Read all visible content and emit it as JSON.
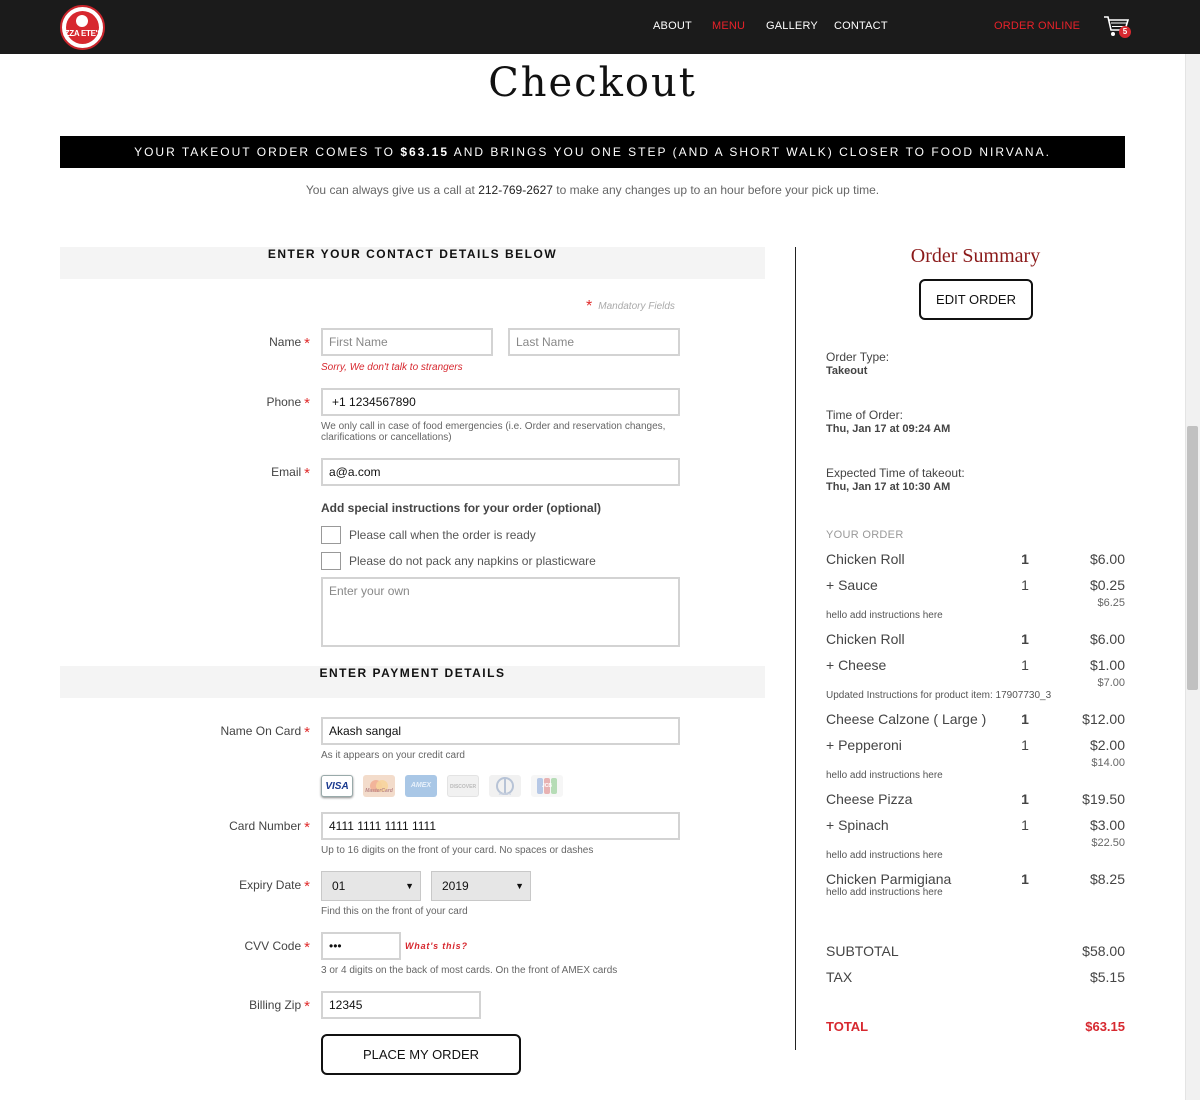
{
  "brand": {
    "logo_text": "IZZA ETE'S",
    "accent": "#d7282f"
  },
  "nav": {
    "about": "ABOUT",
    "menu": "MENU",
    "gallery": "GALLERY",
    "contact": "CONTACT",
    "order_online": "ORDER ONLINE",
    "cart_count": "5"
  },
  "page": {
    "title": "Checkout"
  },
  "banner": {
    "pre": "YOUR TAKEOUT ORDER COMES TO ",
    "amount": "$63.15",
    "post": " AND BRINGS YOU ONE STEP (AND A SHORT WALK) CLOSER TO FOOD NIRVANA."
  },
  "callnote": {
    "pre": "You can always give us a call at ",
    "phone": "212-769-2627",
    "post": " to make any changes up to an hour before your pick up time."
  },
  "contact": {
    "heading": "ENTER YOUR CONTACT DETAILS BELOW",
    "mandatory": "Mandatory Fields",
    "name_label": "Name",
    "first_placeholder": "First Name",
    "last_placeholder": "Last Name",
    "name_error": "Sorry, We don't talk to strangers",
    "phone_label": "Phone",
    "phone_value": "+1 1234567890",
    "phone_help": "We only call in case of food emergencies (i.e. Order and reservation changes, clarifications or cancellations)",
    "email_label": "Email",
    "email_value": "a@a.com",
    "special_heading": "Add special instructions for your order (optional)",
    "opt1": "Please call when the order is ready",
    "opt2": "Please do not pack any napkins or plasticware",
    "own_placeholder": "Enter your own"
  },
  "payment": {
    "heading": "ENTER PAYMENT DETAILS",
    "name_on_card_label": "Name On Card",
    "name_on_card_value": "Akash sangal",
    "name_on_card_help": "As it appears on your credit card",
    "card_logos": [
      "VISA",
      "MasterCard",
      "AMEX",
      "DISCOVER",
      "Diners",
      "JCB"
    ],
    "card_number_label": "Card Number",
    "card_number_value": "4111 1111 1111 1111",
    "card_number_help": "Up to 16 digits on the front of your card. No spaces or dashes",
    "expiry_label": "Expiry Date",
    "expiry_month": "01",
    "expiry_year": "2019",
    "expiry_help": "Find this on the front of your card",
    "cvv_label": "CVV Code",
    "cvv_value": "•••",
    "cvv_link": "What's this?",
    "cvv_help": "3 or 4 digits on the back of most cards. On the front of AMEX cards",
    "zip_label": "Billing Zip",
    "zip_value": "12345",
    "place_order": "PLACE MY ORDER"
  },
  "summary": {
    "title": "Order Summary",
    "edit": "EDIT ORDER",
    "order_type_label": "Order Type:",
    "order_type": "Takeout",
    "time_label": "Time of Order:",
    "time": "Thu, Jan 17 at 09:24 AM",
    "expected_label": "Expected Time of takeout:",
    "expected": "Thu, Jan 17 at 10:30 AM",
    "your_order": "YOUR ORDER",
    "items": [
      {
        "name": "Chicken Roll",
        "qty": "1",
        "price": "$6.00",
        "addon": "+ Sauce",
        "addon_qty": "1",
        "addon_price": "$0.25",
        "subtotal": "$6.25",
        "note": "hello add instructions here"
      },
      {
        "name": "Chicken Roll",
        "qty": "1",
        "price": "$6.00",
        "addon": "+ Cheese",
        "addon_qty": "1",
        "addon_price": "$1.00",
        "subtotal": "$7.00",
        "note": "Updated Instructions for product item: 17907730_3"
      },
      {
        "name": "Cheese Calzone ( Large )",
        "qty": "1",
        "price": "$12.00",
        "addon": "+ Pepperoni",
        "addon_qty": "1",
        "addon_price": "$2.00",
        "subtotal": "$14.00",
        "note": "hello add instructions here"
      },
      {
        "name": "Cheese Pizza",
        "qty": "1",
        "price": "$19.50",
        "addon": "+ Spinach",
        "addon_qty": "1",
        "addon_price": "$3.00",
        "subtotal": "$22.50",
        "note": "hello add instructions here"
      },
      {
        "name": "Chicken Parmigiana",
        "qty": "1",
        "price": "$8.25",
        "note": "hello add instructions here"
      }
    ],
    "subtotal_label": "SUBTOTAL",
    "subtotal": "$58.00",
    "tax_label": "TAX",
    "tax": "$5.15",
    "total_label": "TOTAL",
    "total": "$63.15"
  }
}
